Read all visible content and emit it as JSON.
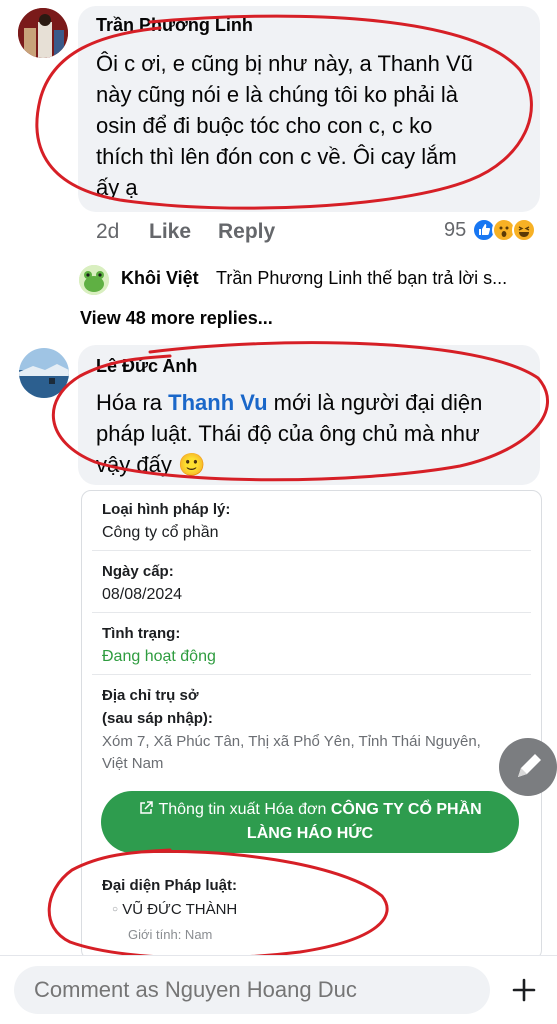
{
  "comments": [
    {
      "author": "Trần Phương Linh",
      "lines": [
        "Ôi c ơi, e cũng bị như này, a Thanh Vũ",
        "này cũng nói e là chúng tôi ko phải là",
        "osin để đi buộc tóc cho con c, c ko",
        "thích thì lên đón con c về. Ôi cay lắm",
        "ấy ạ"
      ],
      "time": "2d",
      "like_label": "Like",
      "reply_label": "Reply",
      "reaction_count": "95",
      "reaction_icons": [
        "like-icon",
        "wow-icon",
        "haha-icon"
      ]
    },
    {
      "author": "Lê Đức Anh",
      "line1_before": "Hóa ra ",
      "line1_mention": "Thanh Vu",
      "line1_after": " mới là người đại diện",
      "line2": "pháp luật. Thái độ của ông chủ mà như",
      "line3": "vậy đấy",
      "emoji": "🙂"
    }
  ],
  "reply_preview": {
    "name": "Khôi Việt",
    "text": "Trần Phương Linh thế bạn trả lời s..."
  },
  "view_more": "View 48 more replies...",
  "company_card": {
    "legal_type_label": "Loại hình pháp lý:",
    "legal_type_value": "Công ty cổ phần",
    "issue_date_label": "Ngày cấp:",
    "issue_date_value": "08/08/2024",
    "status_label": "Tình trạng:",
    "status_value": "Đang hoạt động",
    "address_label_1": "Địa chỉ trụ sở",
    "address_label_2": "(sau sáp nhập):",
    "address_line_1": "Xóm 7, Xã Phúc Tân, Thị xã Phổ Yên, Tỉnh Thái Nguyên,",
    "address_line_2": "Việt Nam",
    "invoice_btn_prefix": "Thông tin xuất Hóa đơn",
    "invoice_btn_company_1": "CÔNG TY CỔ PHẦN",
    "invoice_btn_company_2": "LÀNG HÁO HỨC",
    "rep_label": "Đại diện Pháp luật:",
    "rep_name": "VŨ ĐỨC THÀNH",
    "rep_gender": "Giới tính: Nam"
  },
  "composer": {
    "placeholder": "Comment as Nguyen Hoang Duc",
    "value": ""
  },
  "colors": {
    "mention": "#1a67c9",
    "ink": "#d61f26",
    "green_button": "#2e9c4e",
    "bubble": "#f0f2f5"
  }
}
